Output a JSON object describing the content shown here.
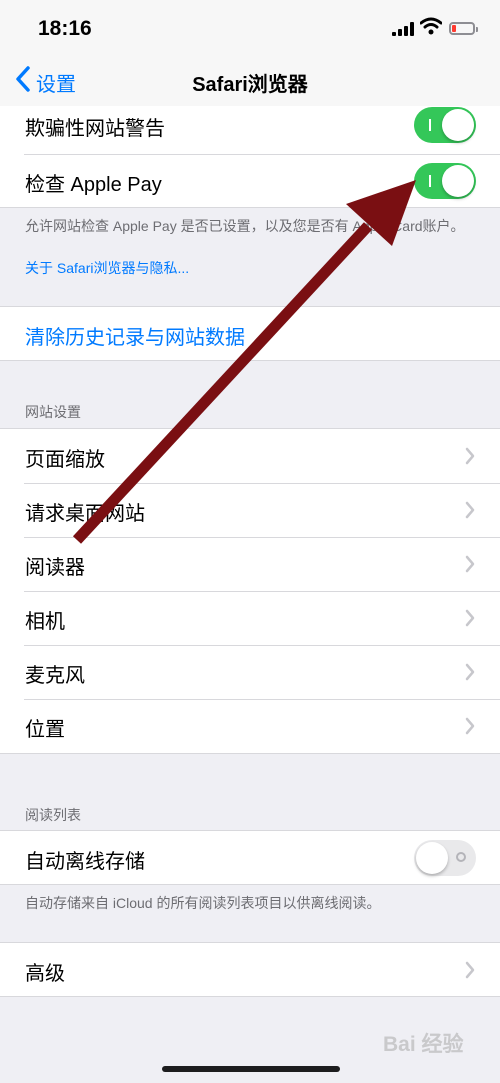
{
  "status_bar": {
    "time": "18:16",
    "battery_color": "#ff3b30"
  },
  "nav": {
    "back_label": "设置",
    "title": "Safari浏览器"
  },
  "privacy_group": {
    "rows": [
      {
        "label": "欺骗性网站警告",
        "toggle": "on"
      },
      {
        "label": "检查 Apple Pay",
        "toggle": "on"
      }
    ],
    "footer_text": "允许网站检查 Apple Pay 是否已设置，以及您是否有 Apple Card账户。",
    "footer_link": "关于 Safari浏览器与隐私..."
  },
  "clear_history": {
    "label": "清除历史记录与网站数据"
  },
  "website_settings": {
    "header": "网站设置",
    "items": [
      {
        "label": "页面缩放"
      },
      {
        "label": "请求桌面网站"
      },
      {
        "label": "阅读器"
      },
      {
        "label": "相机"
      },
      {
        "label": "麦克风"
      },
      {
        "label": "位置"
      }
    ]
  },
  "reading_list": {
    "header": "阅读列表",
    "rows": [
      {
        "label": "自动离线存储",
        "toggle": "off"
      }
    ],
    "footer_text": "自动存储来自 iCloud 的所有阅读列表项目以供离线阅读。"
  },
  "advanced": {
    "label": "高级"
  },
  "watermark": "Bai 经验",
  "colors": {
    "accent": "#007aff",
    "toggle_on": "#34c759",
    "arrow": "#7a0f12",
    "background": "#efeff4"
  }
}
